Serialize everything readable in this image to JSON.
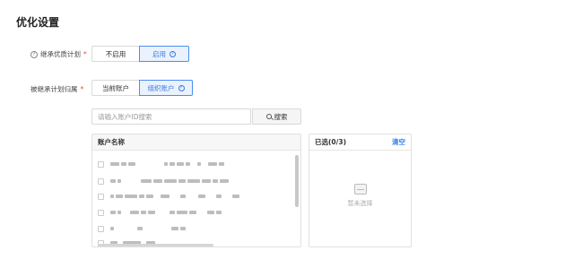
{
  "page": {
    "title": "优化设置"
  },
  "inherit_plan": {
    "label": "继承优质计划",
    "options": [
      {
        "label": "不启用",
        "active": false
      },
      {
        "label": "启用",
        "active": true
      }
    ]
  },
  "plan_owner": {
    "label": "被继承计划归属",
    "options": [
      {
        "label": "当前账户",
        "active": false
      },
      {
        "label": "组织账户",
        "active": true
      }
    ]
  },
  "search": {
    "placeholder": "请输入账户ID搜索",
    "button_label": "搜索"
  },
  "account_list": {
    "header": "账户名称",
    "rows": 6
  },
  "selected_panel": {
    "header": "已选(0/3)",
    "clear_label": "清空",
    "empty_text": "暂未选择"
  },
  "colors": {
    "accent": "#2f80ed",
    "active_bg": "#eaf2fd",
    "required": "#e74c3c"
  },
  "icons": [
    "question-icon",
    "search-icon",
    "empty-inbox-icon"
  ]
}
